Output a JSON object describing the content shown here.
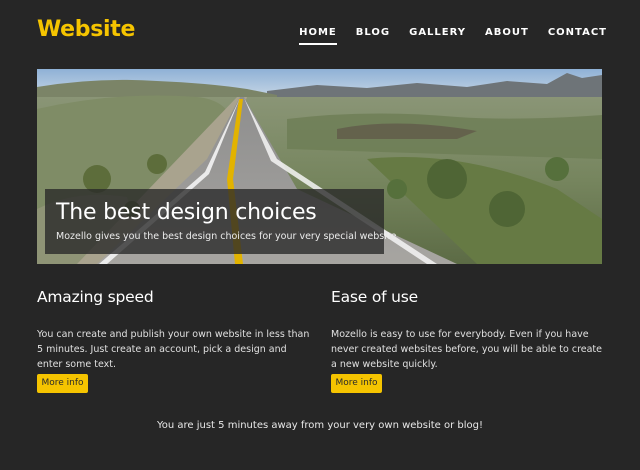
{
  "site": {
    "logo": "Website"
  },
  "nav": {
    "items": [
      {
        "label": "HOME"
      },
      {
        "label": "BLOG"
      },
      {
        "label": "GALLERY"
      },
      {
        "label": "ABOUT"
      },
      {
        "label": "CONTACT"
      }
    ],
    "active": "HOME"
  },
  "hero": {
    "title": "The best design choices",
    "subtitle": "Mozello gives you the best design choices for your very special website",
    "image_subject": "desert-road-landscape"
  },
  "features": [
    {
      "title": "Amazing speed",
      "text": "You can create and publish your own website in less than 5 minutes. Just create an account, pick a design and enter some text.",
      "button": "More info"
    },
    {
      "title": "Ease of use",
      "text": "Mozello is easy to use for everybody. Even if you have never created websites before, you will be able to create a new website quickly.",
      "button": "More info"
    }
  ],
  "footer": {
    "text": "You are just 5 minutes away from your very own website or blog!"
  },
  "colors": {
    "accent": "#f5c400",
    "background": "#262626",
    "text": "#e8e8e8"
  }
}
